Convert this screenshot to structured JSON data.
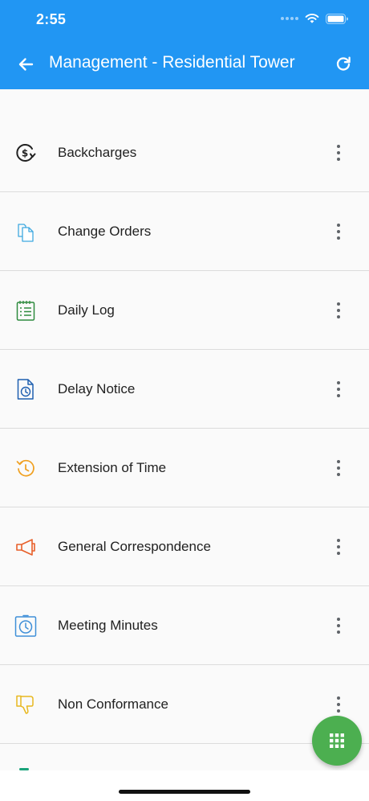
{
  "status_bar": {
    "time": "2:55"
  },
  "app_bar": {
    "title": "Management - Residential Tower"
  },
  "items": [
    {
      "label": "Backcharges",
      "icon": "dollar-cycle-icon",
      "color": "#212121"
    },
    {
      "label": "Change Orders",
      "icon": "copy-document-icon",
      "color": "#3fa9e0"
    },
    {
      "label": "Daily Log",
      "icon": "notepad-list-icon",
      "color": "#2e8b3e"
    },
    {
      "label": "Delay Notice",
      "icon": "document-clock-icon",
      "color": "#1e5fb0"
    },
    {
      "label": "Extension of Time",
      "icon": "clock-history-icon",
      "color": "#f0a020"
    },
    {
      "label": "General Correspondence",
      "icon": "megaphone-icon",
      "color": "#e8602a"
    },
    {
      "label": "Meeting Minutes",
      "icon": "stopwatch-icon",
      "color": "#3f8fd8"
    },
    {
      "label": "Non Conformance",
      "icon": "thumbs-down-icon",
      "color": "#e8b820"
    }
  ],
  "colors": {
    "primary": "#2196f3",
    "fab": "#4caf50"
  }
}
